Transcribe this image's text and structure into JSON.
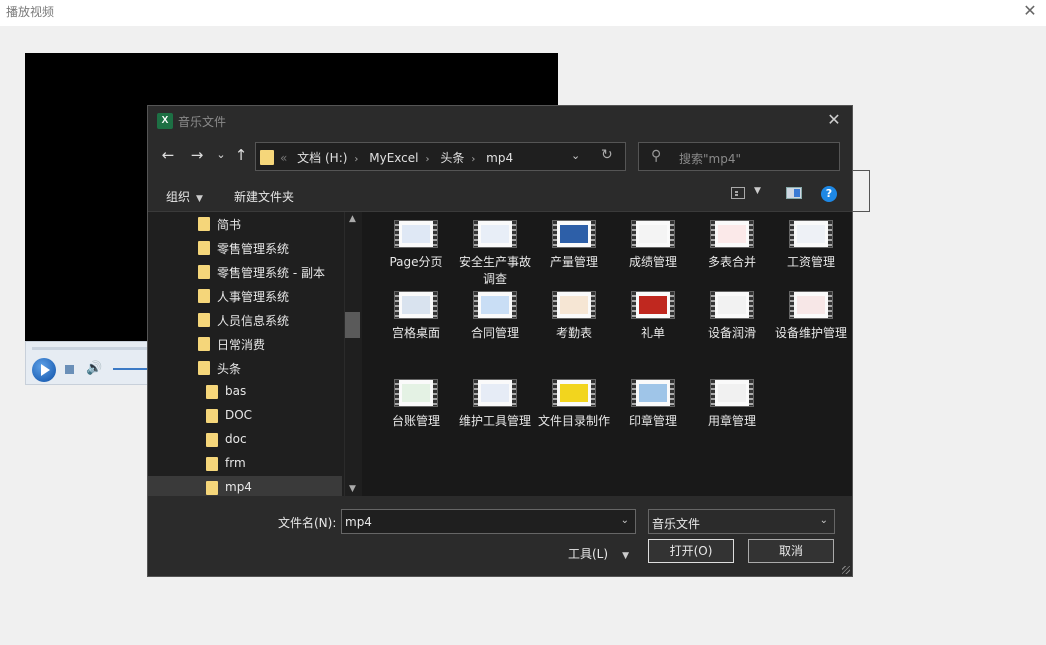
{
  "host": {
    "title": "播放视频",
    "close": "✕"
  },
  "dialog": {
    "title": "音乐文件",
    "app_icon_letter": "X",
    "nav": {
      "back": "←",
      "forward": "→",
      "recent": "⌄",
      "up": "↑"
    },
    "address": {
      "chevron": "«",
      "crumbs": [
        "文档 (H:)",
        "MyExcel",
        "头条",
        "mp4"
      ],
      "refresh": "↻"
    },
    "search": {
      "placeholder": "搜索\"mp4\""
    },
    "toolbar": {
      "organize": "组织",
      "new_folder": "新建文件夹",
      "help": "?"
    },
    "tree": [
      {
        "label": "简书",
        "indent": 1
      },
      {
        "label": "零售管理系统",
        "indent": 1
      },
      {
        "label": "零售管理系统 - 副本",
        "indent": 1
      },
      {
        "label": "人事管理系统",
        "indent": 1
      },
      {
        "label": "人员信息系统",
        "indent": 1
      },
      {
        "label": "日常消费",
        "indent": 1
      },
      {
        "label": "头条",
        "indent": 1
      },
      {
        "label": "bas",
        "indent": 2
      },
      {
        "label": "DOC",
        "indent": 2
      },
      {
        "label": "doc",
        "indent": 2
      },
      {
        "label": "frm",
        "indent": 2
      },
      {
        "label": "mp4",
        "indent": 2,
        "selected": true
      }
    ],
    "files": [
      {
        "name": "Page分页",
        "color": "#dfe8f5"
      },
      {
        "name": "安全生产事故调查",
        "color": "#e8eef7"
      },
      {
        "name": "产量管理",
        "color": "#2d5fa8"
      },
      {
        "name": "成绩管理",
        "color": "#f4f4f4"
      },
      {
        "name": "多表合并",
        "color": "#fbe9e9"
      },
      {
        "name": "工资管理",
        "color": "#eef1f6"
      },
      {
        "name": "宫格桌面",
        "color": "#d9e3ef"
      },
      {
        "name": "合同管理",
        "color": "#c9def5"
      },
      {
        "name": "考勤表",
        "color": "#f6e6d4"
      },
      {
        "name": "礼单",
        "color": "#c0281f"
      },
      {
        "name": "设备润滑",
        "color": "#f2f2f2"
      },
      {
        "name": "设备维护管理",
        "color": "#f7e7e7"
      },
      {
        "name": "台账管理",
        "color": "#e4f2e4"
      },
      {
        "name": "维护工具管理",
        "color": "#e6ecf6"
      },
      {
        "name": "文件目录制作",
        "color": "#f2d51e"
      },
      {
        "name": "印章管理",
        "color": "#9fc5e8"
      },
      {
        "name": "用章管理",
        "color": "#f1f1f1"
      }
    ],
    "filename_label": "文件名(N):",
    "filename_value": "mp4",
    "filetype_value": "音乐文件",
    "tools_label": "工具(L)",
    "open_label": "打开(O)",
    "cancel_label": "取消"
  },
  "colors": {
    "dialog_bg": "#2b2b2b",
    "folder": "#f5d67a",
    "accent": "#1e88e5"
  }
}
